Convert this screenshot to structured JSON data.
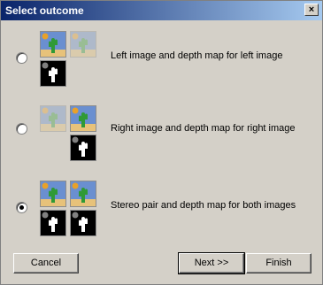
{
  "window": {
    "title": "Select outcome",
    "close_glyph": "×"
  },
  "options": [
    {
      "label": "Left image and depth map for left image",
      "selected": false
    },
    {
      "label": "Right image and depth map for right image",
      "selected": false
    },
    {
      "label": "Stereo pair and depth map for both images",
      "selected": true
    }
  ],
  "buttons": {
    "cancel": "Cancel",
    "next": "Next >>",
    "finish": "Finish"
  },
  "icons": {
    "image": "cactus-image-icon",
    "depth": "cactus-depth-map-icon"
  },
  "colors": {
    "titlebar_start": "#0a246a",
    "titlebar_end": "#a6caf0",
    "dialog_bg": "#d4d0c8",
    "sky": "#6a8fd0",
    "sand": "#e7c27a",
    "sun": "#e8a12a",
    "cactus": "#2f9a36",
    "depth_bg": "#000000",
    "depth_fg": "#ffffff"
  }
}
